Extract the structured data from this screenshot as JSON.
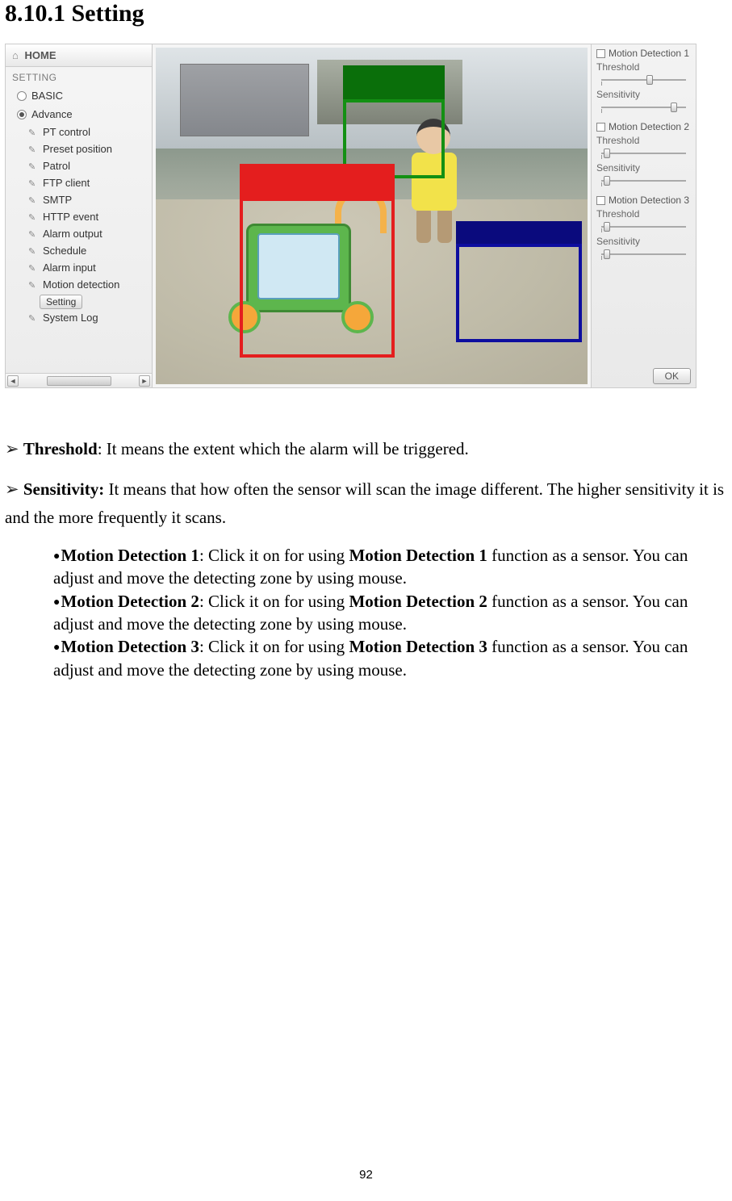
{
  "title": "8.10.1 Setting",
  "page_number": "92",
  "sidebar": {
    "home": "HOME",
    "section": "SETTING",
    "basic": "BASIC",
    "advance": "Advance",
    "items": [
      "PT control",
      "Preset position",
      "Patrol",
      "FTP client",
      "SMTP",
      "HTTP event",
      "Alarm output",
      "Schedule",
      "Alarm input",
      "Motion detection"
    ],
    "setting_btn": "Setting",
    "system_log": "System Log"
  },
  "right_panel": {
    "groups": [
      {
        "title": "Motion Detection 1"
      },
      {
        "title": "Motion Detection 2"
      },
      {
        "title": "Motion Detection 3"
      }
    ],
    "threshold_label": "Threshold",
    "sensitivity_label": "Sensitivity",
    "ok": "OK"
  },
  "body": {
    "threshold_term": "Threshold",
    "threshold_text": ": It means the extent which the alarm will be triggered.",
    "sensitivity_term": "Sensitivity:",
    "sensitivity_text": " It means that how often the sensor will scan the image different. The higher sensitivity it is and the more frequently it scans.",
    "md_items": [
      {
        "head": "Motion Detection 1",
        "mid": ": Click it on for using ",
        "head2": "Motion Detection 1",
        "tail": " function as a sensor. You can adjust and move the detecting zone by using mouse."
      },
      {
        "head": "Motion Detection 2",
        "mid": ": Click it on for using ",
        "head2": "Motion Detection 2",
        "tail": " function as a sensor. You can adjust and move the detecting zone by using mouse."
      },
      {
        "head": "Motion Detection 3",
        "mid": ": Click it on for using ",
        "head2": "Motion Detection 3",
        "tail": " function as a sensor. You can adjust and move the detecting zone by using mouse."
      }
    ]
  }
}
